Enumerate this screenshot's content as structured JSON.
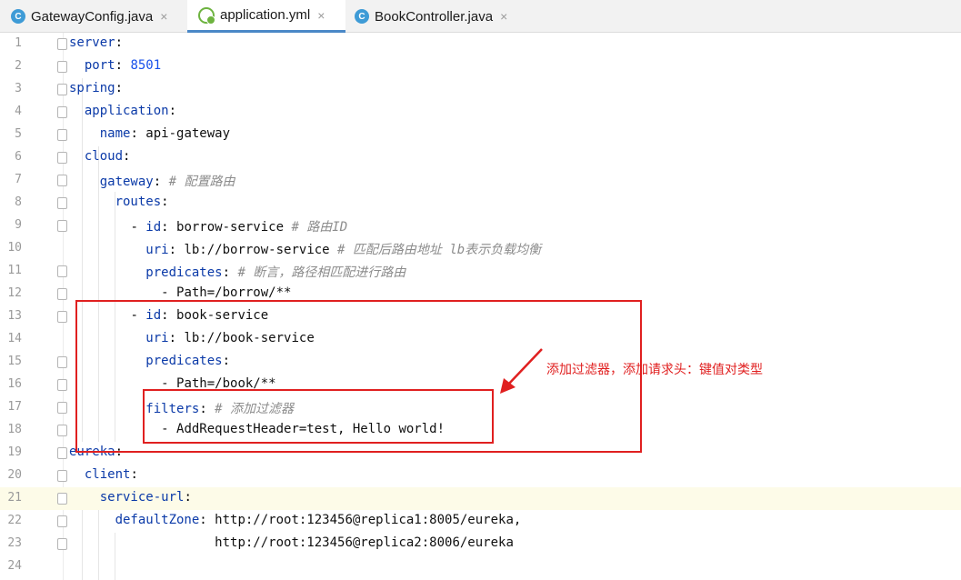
{
  "tabs": [
    {
      "label": "GatewayConfig.java",
      "icon": "java-class-icon",
      "close": "×",
      "active": false
    },
    {
      "label": "application.yml",
      "icon": "spring-yaml-icon",
      "close": "×",
      "active": true
    },
    {
      "label": "BookController.java",
      "icon": "java-class-icon",
      "close": "×",
      "active": false
    }
  ],
  "tab_icon_letter": "C",
  "editor": {
    "highlighted_line": 21,
    "lines": [
      {
        "n": "1"
      },
      {
        "n": "2"
      },
      {
        "n": "3"
      },
      {
        "n": "4"
      },
      {
        "n": "5"
      },
      {
        "n": "6"
      },
      {
        "n": "7"
      },
      {
        "n": "8"
      },
      {
        "n": "9"
      },
      {
        "n": "10"
      },
      {
        "n": "11"
      },
      {
        "n": "12"
      },
      {
        "n": "13"
      },
      {
        "n": "14"
      },
      {
        "n": "15"
      },
      {
        "n": "16"
      },
      {
        "n": "17"
      },
      {
        "n": "18"
      },
      {
        "n": "19"
      },
      {
        "n": "20"
      },
      {
        "n": "21"
      },
      {
        "n": "22"
      },
      {
        "n": "23"
      },
      {
        "n": "24"
      }
    ],
    "code": {
      "l1": {
        "key": "server",
        "colon": ":"
      },
      "l2": {
        "key": "port",
        "colon": ": ",
        "value": "8501"
      },
      "l3": {
        "key": "spring",
        "colon": ":"
      },
      "l4": {
        "key": "application",
        "colon": ":"
      },
      "l5": {
        "key": "name",
        "colon": ": ",
        "value": "api-gateway"
      },
      "l6": {
        "key": "cloud",
        "colon": ":"
      },
      "l7": {
        "key": "gateway",
        "colon": ": ",
        "comment": "# 配置路由"
      },
      "l8": {
        "key": "routes",
        "colon": ":"
      },
      "l9": {
        "dash": "- ",
        "key": "id",
        "colon": ": ",
        "value": "borrow-service ",
        "comment": "# 路由ID"
      },
      "l10": {
        "key": "uri",
        "colon": ": ",
        "value": "lb://borrow-service ",
        "comment": "# 匹配后路由地址 lb表示负载均衡"
      },
      "l11": {
        "key": "predicates",
        "colon": ": ",
        "comment": "# 断言，路径相匹配进行路由"
      },
      "l12": {
        "value": "- Path=/borrow/**"
      },
      "l13": {
        "dash": "- ",
        "key": "id",
        "colon": ": ",
        "value": "book-service"
      },
      "l14": {
        "key": "uri",
        "colon": ": ",
        "value": "lb://book-service"
      },
      "l15": {
        "key": "predicates",
        "colon": ":"
      },
      "l16": {
        "value": "- Path=/book/**"
      },
      "l17": {
        "key": "filters",
        "colon": ": ",
        "comment": "# 添加过滤器"
      },
      "l18": {
        "value": "- AddRequestHeader=test, Hello world!"
      },
      "l19": {
        "key": "eureka",
        "colon": ":"
      },
      "l20": {
        "key": "client",
        "colon": ":"
      },
      "l21": {
        "key": "service-url",
        "colon": ":"
      },
      "l22": {
        "key": "defaultZone",
        "colon": ": ",
        "value": "http://root:123456@replica1:8005/eureka,"
      },
      "l23": {
        "value": "http://root:123456@replica2:8006/eureka"
      }
    }
  },
  "annotation": {
    "text": "添加过滤器，添加请求头：键值对类型",
    "color": "#e02020"
  }
}
